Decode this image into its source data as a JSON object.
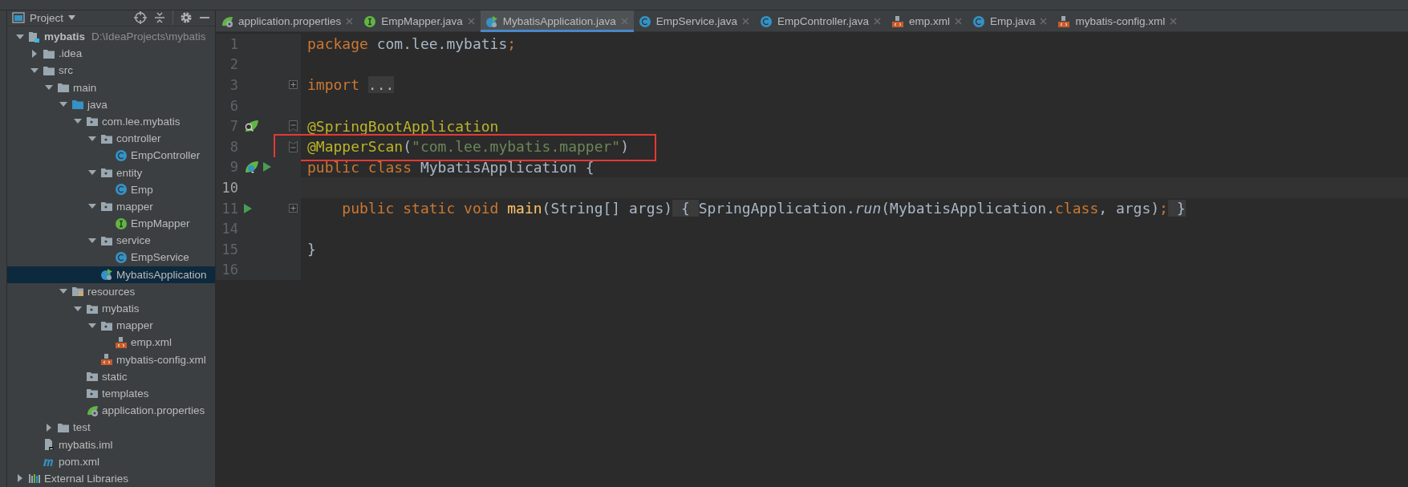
{
  "project_panel": {
    "title": "Project",
    "tree": [
      {
        "name": "mybatis",
        "path": "D:\\IdeaProjects\\mybatis",
        "kind": "module",
        "expanded": true,
        "selected": false,
        "children": [
          {
            "name": ".idea",
            "kind": "folder",
            "expanded": false,
            "selected": false
          },
          {
            "name": "src",
            "kind": "folder",
            "expanded": true,
            "selected": false,
            "children": [
              {
                "name": "main",
                "kind": "folder",
                "expanded": true,
                "selected": false,
                "children": [
                  {
                    "name": "java",
                    "kind": "source",
                    "expanded": true,
                    "selected": false,
                    "children": [
                      {
                        "name": "com.lee.mybatis",
                        "kind": "package",
                        "expanded": true,
                        "selected": false,
                        "children": [
                          {
                            "name": "controller",
                            "kind": "package",
                            "expanded": true,
                            "selected": false,
                            "children": [
                              {
                                "name": "EmpController",
                                "kind": "class",
                                "selected": false
                              }
                            ]
                          },
                          {
                            "name": "entity",
                            "kind": "package",
                            "expanded": true,
                            "selected": false,
                            "children": [
                              {
                                "name": "Emp",
                                "kind": "class",
                                "selected": false
                              }
                            ]
                          },
                          {
                            "name": "mapper",
                            "kind": "package",
                            "expanded": true,
                            "selected": false,
                            "children": [
                              {
                                "name": "EmpMapper",
                                "kind": "interface",
                                "selected": false
                              }
                            ]
                          },
                          {
                            "name": "service",
                            "kind": "package",
                            "expanded": true,
                            "selected": false,
                            "children": [
                              {
                                "name": "EmpService",
                                "kind": "class",
                                "selected": false
                              }
                            ]
                          },
                          {
                            "name": "MybatisApplication",
                            "kind": "application",
                            "selected": true
                          }
                        ]
                      }
                    ]
                  },
                  {
                    "name": "resources",
                    "kind": "resources",
                    "expanded": true,
                    "selected": false,
                    "children": [
                      {
                        "name": "mybatis",
                        "kind": "package",
                        "expanded": true,
                        "selected": false,
                        "children": [
                          {
                            "name": "mapper",
                            "kind": "package",
                            "expanded": true,
                            "selected": false,
                            "children": [
                              {
                                "name": "emp.xml",
                                "kind": "xml",
                                "selected": false
                              }
                            ]
                          },
                          {
                            "name": "mybatis-config.xml",
                            "kind": "xml",
                            "selected": false
                          }
                        ]
                      },
                      {
                        "name": "static",
                        "kind": "package",
                        "selected": false
                      },
                      {
                        "name": "templates",
                        "kind": "package",
                        "selected": false
                      },
                      {
                        "name": "application.properties",
                        "kind": "properties",
                        "selected": false
                      }
                    ]
                  }
                ]
              },
              {
                "name": "test",
                "kind": "folder",
                "expanded": false,
                "selected": false
              }
            ]
          },
          {
            "name": "mybatis.iml",
            "kind": "iml",
            "selected": false
          },
          {
            "name": "pom.xml",
            "kind": "maven",
            "selected": false
          }
        ]
      },
      {
        "name": "External Libraries",
        "kind": "library",
        "expanded": false,
        "selected": false
      }
    ]
  },
  "tabs": [
    {
      "label": "application.properties",
      "kind": "properties",
      "selected": false
    },
    {
      "label": "EmpMapper.java",
      "kind": "interface",
      "selected": false
    },
    {
      "label": "MybatisApplication.java",
      "kind": "application",
      "selected": true
    },
    {
      "label": "EmpService.java",
      "kind": "class",
      "selected": false
    },
    {
      "label": "EmpController.java",
      "kind": "class",
      "selected": false
    },
    {
      "label": "emp.xml",
      "kind": "xml",
      "selected": false
    },
    {
      "label": "Emp.java",
      "kind": "class",
      "selected": false
    },
    {
      "label": "mybatis-config.xml",
      "kind": "xml",
      "selected": false
    }
  ],
  "editor": {
    "lines": [
      {
        "number": "1",
        "current": false,
        "tokens": [
          {
            "text": "package",
            "kind": "keyword"
          },
          {
            "text": " com.lee.mybatis",
            "kind": "plain"
          },
          {
            "text": ";",
            "kind": "keyword"
          }
        ]
      },
      {
        "number": "2",
        "current": false
      },
      {
        "number": "3",
        "current": false,
        "fold": {
          "kind": "expand"
        },
        "tokens": [
          {
            "text": "import ",
            "kind": "keyword"
          },
          {
            "text": "...",
            "kind": "folded"
          }
        ]
      },
      {
        "number": "6",
        "current": false
      },
      {
        "number": "7",
        "current": false,
        "gutter_icons": [
          {
            "kind": "bean-search"
          }
        ],
        "fold": {
          "kind": "collapse"
        },
        "tokens": [
          {
            "text": "@SpringBootApplication",
            "kind": "annotation"
          }
        ]
      },
      {
        "number": "8",
        "current": false,
        "fold": {
          "kind": "end"
        },
        "framed": true,
        "tokens": [
          {
            "text": "@MapperScan",
            "kind": "annotation"
          },
          {
            "text": "(",
            "kind": "plain"
          },
          {
            "text": "\"com.lee.mybatis.mapper\"",
            "kind": "string"
          },
          {
            "text": ")",
            "kind": "plain"
          }
        ]
      },
      {
        "number": "9",
        "current": false,
        "gutter_icons": [
          {
            "kind": "bean-class"
          },
          {
            "kind": "run"
          }
        ],
        "tokens": [
          {
            "text": "public class",
            "kind": "keyword"
          },
          {
            "text": " MybatisApplication {",
            "kind": "plain"
          }
        ]
      },
      {
        "number": "10",
        "current": true
      },
      {
        "number": "11",
        "current": false,
        "gutter_icons": [
          {
            "kind": "run"
          }
        ],
        "fold": {
          "kind": "expand"
        },
        "tokens": [
          {
            "text": "    public static void ",
            "kind": "keyword"
          },
          {
            "text": "main",
            "kind": "method"
          },
          {
            "text": "(String[] args)",
            "kind": "plain"
          },
          {
            "text": " { ",
            "kind": "folded"
          },
          {
            "text": "SpringApplication.",
            "kind": "plain"
          },
          {
            "text": "run",
            "kind": "italic"
          },
          {
            "text": "(MybatisApplication.",
            "kind": "plain"
          },
          {
            "text": "class",
            "kind": "keyword"
          },
          {
            "text": ", args)",
            "kind": "plain"
          },
          {
            "text": ";",
            "kind": "keyword"
          },
          {
            "text": " }",
            "kind": "folded"
          }
        ]
      },
      {
        "number": "14",
        "current": false
      },
      {
        "number": "15",
        "current": false,
        "tokens": [
          {
            "text": "}",
            "kind": "plain"
          }
        ]
      },
      {
        "number": "16",
        "current": false
      }
    ]
  }
}
